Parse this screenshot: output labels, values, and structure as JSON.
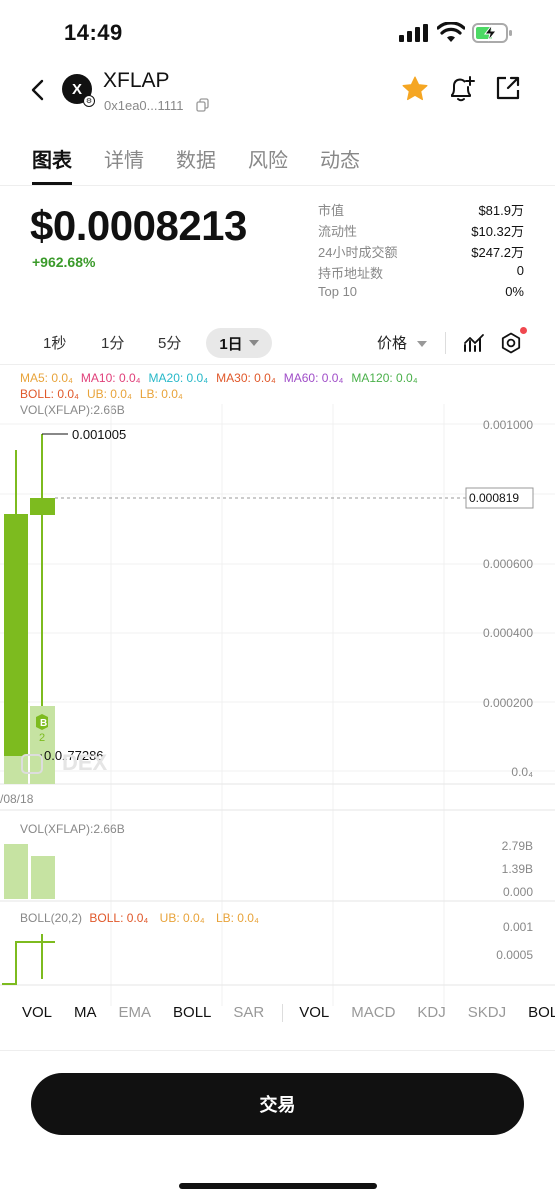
{
  "status": {
    "time": "14:49"
  },
  "token": {
    "symbol": "XFLAP",
    "logo_letter": "X",
    "address": "0x1ea0...1111"
  },
  "tabs": [
    {
      "label": "图表",
      "active": true
    },
    {
      "label": "详情"
    },
    {
      "label": "数据"
    },
    {
      "label": "风险"
    },
    {
      "label": "动态"
    }
  ],
  "price": {
    "value": "$0.0008213",
    "change": "+962.68%"
  },
  "stats": [
    {
      "key": "市值",
      "value": "$81.9万"
    },
    {
      "key": "流动性",
      "value": "$10.32万"
    },
    {
      "key": "24小时成交额",
      "value": "$247.2万"
    },
    {
      "key": "持币地址数",
      "value": "0"
    },
    {
      "key": "Top 10",
      "value": "0%"
    }
  ],
  "intervals": {
    "i1": "1秒",
    "i2": "1分",
    "i3": "5分",
    "selected": "1日",
    "price_select": "价格"
  },
  "indicators": {
    "ma": [
      {
        "label": "MA5: 0.0₄",
        "color": "#e8a33a"
      },
      {
        "label": "MA10: 0.0₄",
        "color": "#e0407a"
      },
      {
        "label": "MA20: 0.0₄",
        "color": "#27b8c8"
      },
      {
        "label": "MA30: 0.0₄",
        "color": "#e0582a"
      },
      {
        "label": "MA60: 0.0₄",
        "color": "#a04ec8"
      },
      {
        "label": "MA120: 0.0₄",
        "color": "#4ab04a"
      }
    ],
    "boll": [
      {
        "label": "BOLL: 0.0₄",
        "color": "#e0582a"
      },
      {
        "label": "UB: 0.0₄",
        "color": "#e8a33a"
      },
      {
        "label": "LB: 0.0₄",
        "color": "#e8a33a"
      }
    ],
    "vol_label": "VOL(XFLAP):2.66B"
  },
  "chart": {
    "y_labels": [
      "0.001000",
      "0.000600",
      "0.000400",
      "0.000200",
      "0.0₄"
    ],
    "current_price": "0.000819",
    "high_label": "0.001005",
    "low_label": "0.0₄77286",
    "buy_marker": "B",
    "buy_count": "2",
    "date_label": "/08/18",
    "watermark": "DEX",
    "vol_title": "VOL(XFLAP):2.66B",
    "vol_y": [
      "2.79B",
      "1.39B",
      "0.000"
    ],
    "boll_title": "BOLL(20,2)",
    "boll_items": [
      {
        "label": "BOLL: 0.0₄",
        "color": "#e0582a"
      },
      {
        "label": "UB: 0.0₄",
        "color": "#e8a33a"
      },
      {
        "label": "LB: 0.0₄",
        "color": "#e8a33a"
      }
    ],
    "boll_y": [
      "0.001",
      "0.0005"
    ]
  },
  "bottom_tabs": [
    {
      "label": "VOL",
      "active": true
    },
    {
      "label": "MA",
      "active": true
    },
    {
      "label": "EMA",
      "active": false
    },
    {
      "label": "BOLL",
      "active": true
    },
    {
      "label": "SAR",
      "active": false
    },
    {
      "label": "VOL",
      "active": true
    },
    {
      "label": "MACD",
      "active": false
    },
    {
      "label": "KDJ",
      "active": false
    },
    {
      "label": "SKDJ",
      "active": false
    },
    {
      "label": "BOLL",
      "active": true
    }
  ],
  "trade_button": "交易",
  "colors": {
    "up": "#3a9a2a",
    "candle": "#7dbb1f",
    "candle_light": "#c6e3a2",
    "badge": "#f0484f"
  }
}
